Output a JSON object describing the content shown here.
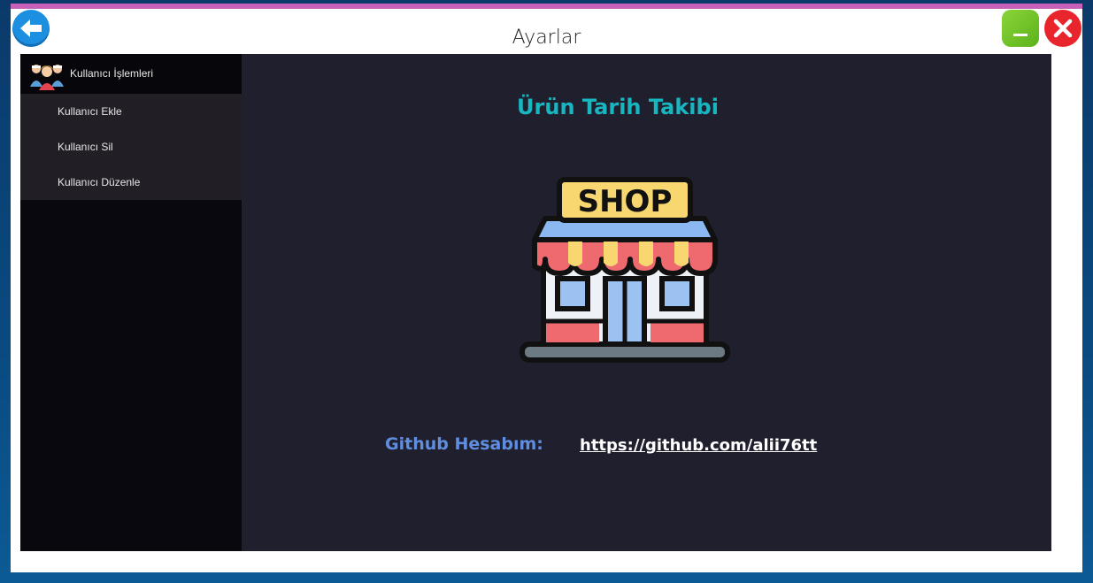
{
  "window": {
    "title": "Ayarlar"
  },
  "controls": {
    "back_icon": "back-arrow-icon",
    "minimize_icon": "minimize-icon",
    "close_icon": "close-icon"
  },
  "sidebar": {
    "header": {
      "label": "Kullanıcı İşlemleri",
      "icon": "users-group-icon"
    },
    "items": [
      {
        "label": "Kullanıcı Ekle"
      },
      {
        "label": "Kullanıcı Sil"
      },
      {
        "label": "Kullanıcı Düzenle"
      }
    ]
  },
  "main": {
    "app_title": "Ürün Tarih Takibi",
    "shop_sign": "SHOP",
    "shop_icon": "shop-icon",
    "github_label": "Github Hesabım:",
    "github_link": "https://github.com/alii76tt"
  },
  "colors": {
    "accent": "#c761b8",
    "title_cyan": "#18b6c1",
    "label_blue": "#5f8ee0",
    "sidebar_bg": "#09080f",
    "main_bg": "#201f2d"
  }
}
